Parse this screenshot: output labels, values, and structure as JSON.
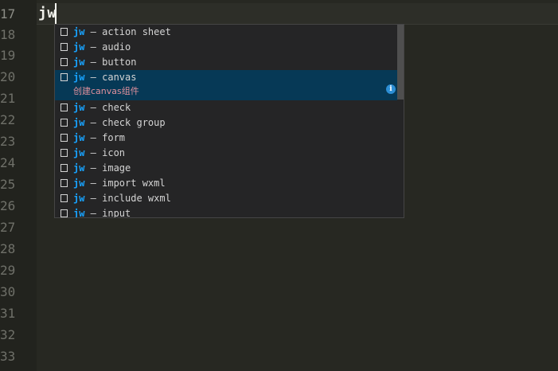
{
  "editor": {
    "line_numbers": [
      "17",
      "18",
      "19",
      "20",
      "21",
      "22",
      "23",
      "24",
      "25",
      "26",
      "27",
      "28",
      "29",
      "30",
      "31",
      "32",
      "33"
    ],
    "typed_text": "jw"
  },
  "suggest": {
    "items": [
      {
        "prefix": "jw",
        "label": " – action sheet"
      },
      {
        "prefix": "jw",
        "label": " – audio"
      },
      {
        "prefix": "jw",
        "label": " – button"
      },
      {
        "prefix": "jw",
        "label": " – canvas"
      },
      {
        "prefix": "jw",
        "label": " – check"
      },
      {
        "prefix": "jw",
        "label": " – check group"
      },
      {
        "prefix": "jw",
        "label": " – form"
      },
      {
        "prefix": "jw",
        "label": " – icon"
      },
      {
        "prefix": "jw",
        "label": " – image"
      },
      {
        "prefix": "jw",
        "label": " – import wxml"
      },
      {
        "prefix": "jw",
        "label": " – include wxml"
      },
      {
        "prefix": "jw",
        "label": " – input"
      }
    ],
    "selected_index": 3,
    "selected_detail": "创建canvas组件",
    "info_icon_glyph": "i",
    "item_kind_icon": "snippet-icon",
    "colors": {
      "match": "#18a3ff",
      "selected_background": "#063956",
      "detail": "#e0909c"
    }
  }
}
